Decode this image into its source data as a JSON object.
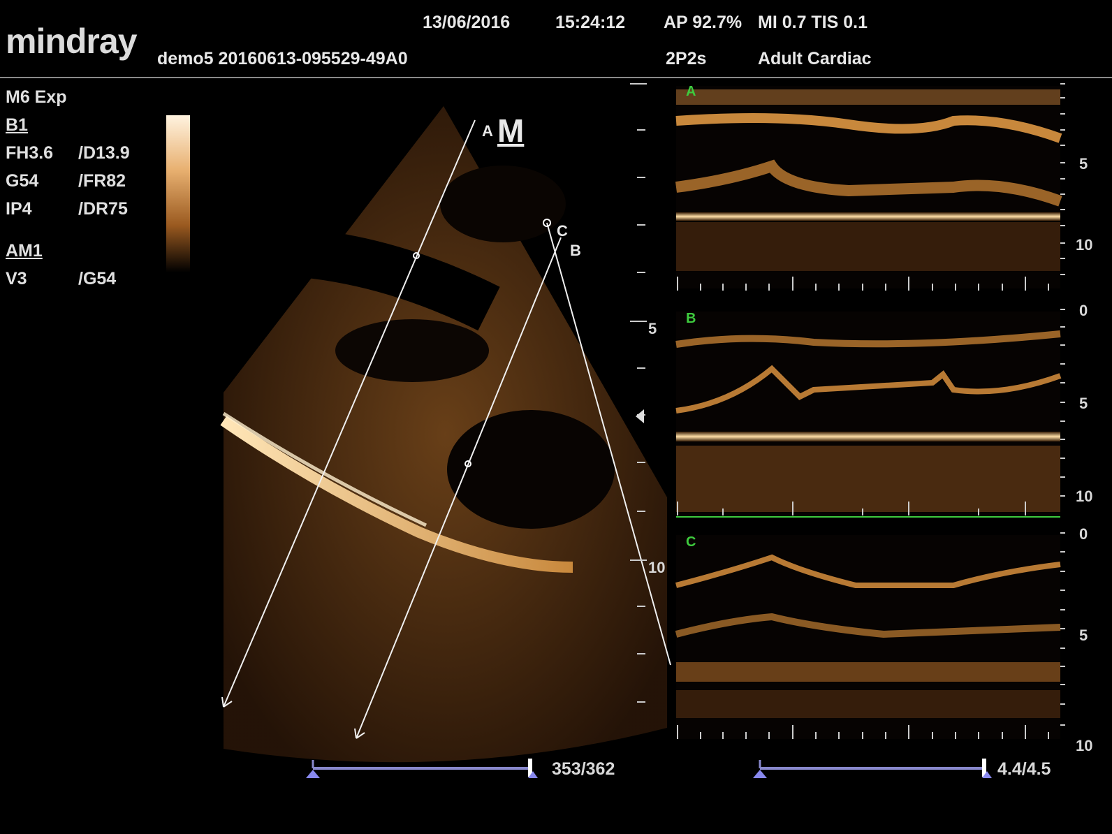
{
  "header": {
    "logo": "mindray",
    "patient_id": "demo5 20160613-095529-49A0",
    "date": "13/06/2016",
    "time": "15:24:12",
    "ap": "AP 92.7%",
    "mi_tis": "MI 0.7 TIS 0.1",
    "probe": "2P2s",
    "preset": "Adult Cardiac"
  },
  "params": {
    "mode": "M6 Exp",
    "b_section": "B1",
    "fh": "FH3.6",
    "d": "/D13.9",
    "g": "G54",
    "fr": "/FR82",
    "ip": "IP4",
    "dr": "/DR75",
    "am_section": "AM1",
    "v": "V3",
    "g2": "/G54"
  },
  "bmode": {
    "line_a": "A",
    "line_b": "B",
    "line_c": "C",
    "m_marker": "M",
    "depth_5": "5",
    "depth_10": "10"
  },
  "mmode": {
    "panels": [
      {
        "label": "A",
        "ticks": [
          "5",
          "10"
        ]
      },
      {
        "label": "B",
        "ticks": [
          "0",
          "5",
          "10"
        ]
      },
      {
        "label": "C",
        "ticks": [
          "0",
          "5",
          "10"
        ]
      }
    ]
  },
  "footer": {
    "frame_counter": "353/362",
    "time_counter": "4.4/4.5"
  },
  "colors": {
    "tissue": "#c8883c",
    "bright": "#ffe6b8",
    "label_green": "#3ecb3e"
  }
}
